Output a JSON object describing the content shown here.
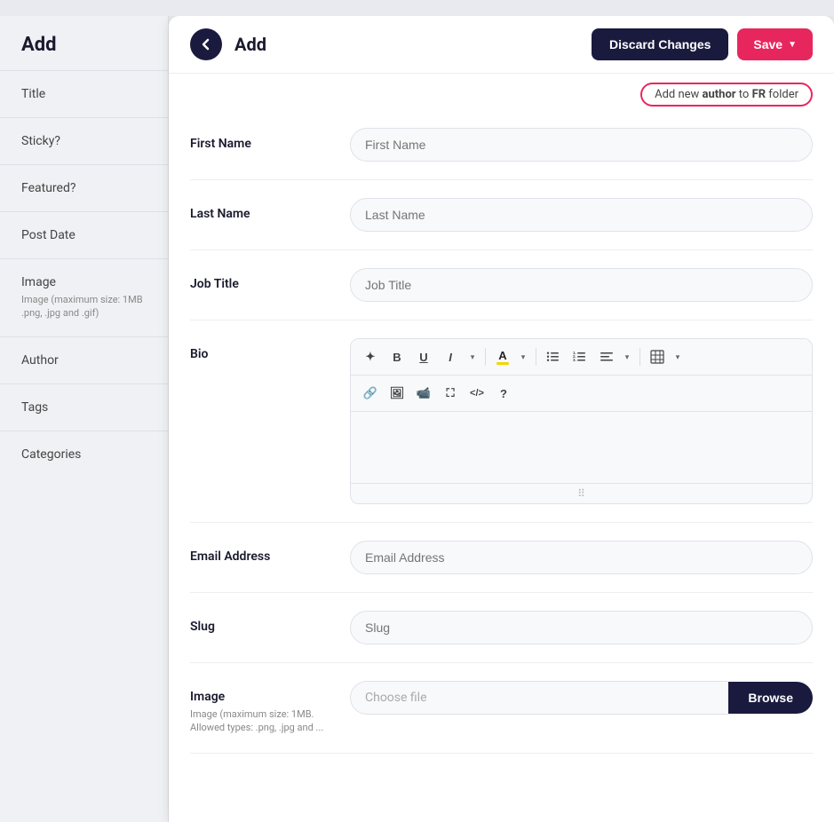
{
  "sidebar": {
    "title": "Add",
    "items": [
      {
        "id": "title",
        "label": "Title",
        "sub": ""
      },
      {
        "id": "sticky",
        "label": "Sticky?",
        "sub": ""
      },
      {
        "id": "featured",
        "label": "Featured?",
        "sub": ""
      },
      {
        "id": "post-date",
        "label": "Post Date",
        "sub": ""
      },
      {
        "id": "image",
        "label": "Image",
        "sub": "Image (maximum size: 1MB .png, .jpg and .gif)"
      },
      {
        "id": "author",
        "label": "Author",
        "sub": ""
      },
      {
        "id": "tags",
        "label": "Tags",
        "sub": ""
      },
      {
        "id": "categories",
        "label": "Categories",
        "sub": ""
      }
    ]
  },
  "panel": {
    "title": "Add",
    "back_label": "‹",
    "discard_label": "Discard Changes",
    "save_label": "Save",
    "hint": {
      "prefix": "Add new ",
      "author_word": "author",
      "middle": " to ",
      "folder": "FR",
      "suffix": " folder"
    }
  },
  "form": {
    "fields": [
      {
        "id": "first-name",
        "label": "First Name",
        "placeholder": "First Name",
        "type": "text"
      },
      {
        "id": "last-name",
        "label": "Last Name",
        "placeholder": "Last Name",
        "type": "text"
      },
      {
        "id": "job-title",
        "label": "Job Title",
        "placeholder": "Job Title",
        "type": "text"
      },
      {
        "id": "bio",
        "label": "Bio",
        "placeholder": "",
        "type": "rich"
      },
      {
        "id": "email",
        "label": "Email Address",
        "placeholder": "Email Address",
        "type": "text"
      },
      {
        "id": "slug",
        "label": "Slug",
        "placeholder": "Slug",
        "type": "text"
      },
      {
        "id": "image",
        "label": "Image",
        "sub_label": "Image (maximum size: 1MB. Allowed types: .png, .jpg and ...",
        "placeholder": "Choose file",
        "type": "file"
      }
    ],
    "toolbar": {
      "buttons": [
        {
          "id": "magic",
          "display": "✦"
        },
        {
          "id": "bold",
          "display": "B"
        },
        {
          "id": "underline",
          "display": "U"
        },
        {
          "id": "italic",
          "display": "𝐼"
        },
        {
          "id": "more-format",
          "display": "▾"
        },
        {
          "id": "font-color",
          "display": "A",
          "color": "#f5d400"
        },
        {
          "id": "font-color-drop",
          "display": "▾"
        },
        {
          "id": "list-unordered",
          "display": "≡"
        },
        {
          "id": "list-ordered",
          "display": "☰"
        },
        {
          "id": "align",
          "display": "≡"
        },
        {
          "id": "align-drop",
          "display": "▾"
        },
        {
          "id": "table",
          "display": "⊞"
        },
        {
          "id": "table-drop",
          "display": "▾"
        }
      ],
      "buttons2": [
        {
          "id": "link",
          "display": "🔗"
        },
        {
          "id": "image",
          "display": "🖼"
        },
        {
          "id": "video",
          "display": "▶"
        },
        {
          "id": "expand",
          "display": "⛶"
        },
        {
          "id": "code",
          "display": "</>"
        },
        {
          "id": "help",
          "display": "?"
        }
      ]
    },
    "browse_label": "Browse"
  }
}
